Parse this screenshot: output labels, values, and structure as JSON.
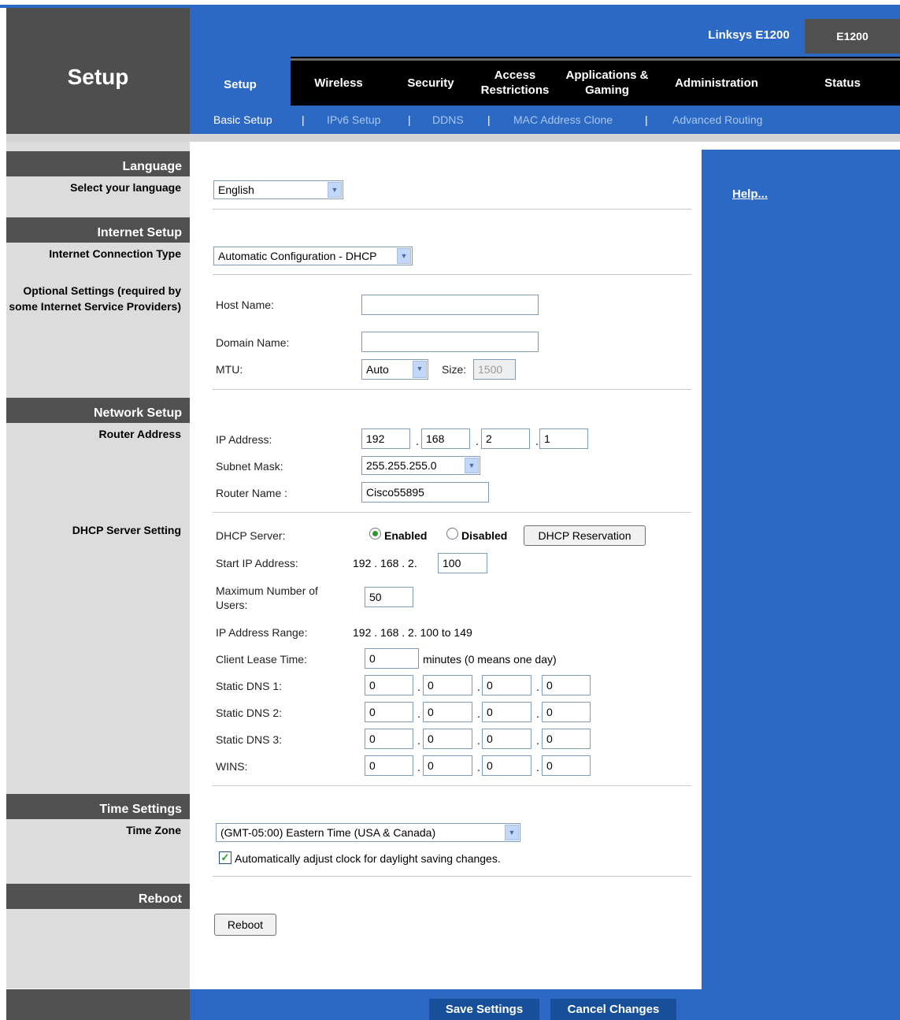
{
  "header": {
    "page_title": "Setup",
    "brand": "Linksys E1200",
    "model": "E1200",
    "tabs": [
      {
        "label": "Setup"
      },
      {
        "label": "Wireless"
      },
      {
        "label": "Security"
      },
      {
        "label": "Access Restrictions"
      },
      {
        "label": "Applications & Gaming"
      },
      {
        "label": "Administration"
      },
      {
        "label": "Status"
      }
    ],
    "subtabs": [
      {
        "label": "Basic Setup"
      },
      {
        "label": "IPv6 Setup"
      },
      {
        "label": "DDNS"
      },
      {
        "label": "MAC Address Clone"
      },
      {
        "label": "Advanced Routing"
      }
    ],
    "separator": "|"
  },
  "help": {
    "label": "Help..."
  },
  "sections": {
    "language": {
      "title": "Language",
      "label": "Select your language",
      "value": "English"
    },
    "internet": {
      "title": "Internet Setup",
      "conn_label": "Internet Connection Type",
      "conn_value": "Automatic Configuration - DHCP",
      "optional_label": "Optional Settings (required by some Internet Service Providers)",
      "host_label": "Host Name:",
      "host_value": "",
      "domain_label": "Domain Name:",
      "domain_value": "",
      "mtu_label": "MTU:",
      "mtu_value": "Auto",
      "size_label": "Size:",
      "size_value": "1500"
    },
    "network": {
      "title": "Network Setup",
      "router_label": "Router Address",
      "ip_label": "IP Address:",
      "ip": [
        "192",
        "168",
        "2",
        "1"
      ],
      "subnet_label": "Subnet Mask:",
      "subnet_value": "255.255.255.0",
      "router_name_label": "Router Name :",
      "router_name_value": "Cisco55895",
      "dhcp_setting_label": "DHCP Server Setting",
      "dhcp_server_label": "DHCP Server:",
      "enabled_label": "Enabled",
      "disabled_label": "Disabled",
      "reservation_button": "DHCP Reservation",
      "start_ip_label": "Start IP Address:",
      "start_ip_prefix": "192 . 168 . 2.",
      "start_ip_value": "100",
      "max_users_label": "Maximum Number of Users:",
      "max_users_value": "50",
      "range_label": "IP Address Range:",
      "range_value": "192 . 168 . 2. 100 to 149",
      "lease_label": "Client Lease Time:",
      "lease_value": "0",
      "lease_note": "minutes (0 means one day)",
      "dns_rows": [
        {
          "label": "Static DNS 1:",
          "values": [
            "0",
            "0",
            "0",
            "0"
          ]
        },
        {
          "label": "Static DNS 2:",
          "values": [
            "0",
            "0",
            "0",
            "0"
          ]
        },
        {
          "label": "Static DNS 3:",
          "values": [
            "0",
            "0",
            "0",
            "0"
          ]
        },
        {
          "label": "WINS:",
          "values": [
            "0",
            "0",
            "0",
            "0"
          ]
        }
      ]
    },
    "time": {
      "title": "Time Settings",
      "zone_label": "Time Zone",
      "zone_value": "(GMT-05:00) Eastern Time (USA & Canada)",
      "dst_label": "Automatically adjust clock for daylight saving changes."
    },
    "reboot": {
      "title": "Reboot",
      "button": "Reboot"
    }
  },
  "footer": {
    "save": "Save Settings",
    "cancel": "Cancel Changes"
  },
  "colors": {
    "accent_blue": "#2b69c4",
    "dark_gray": "#505050",
    "light_gray": "#dcdcdc"
  }
}
